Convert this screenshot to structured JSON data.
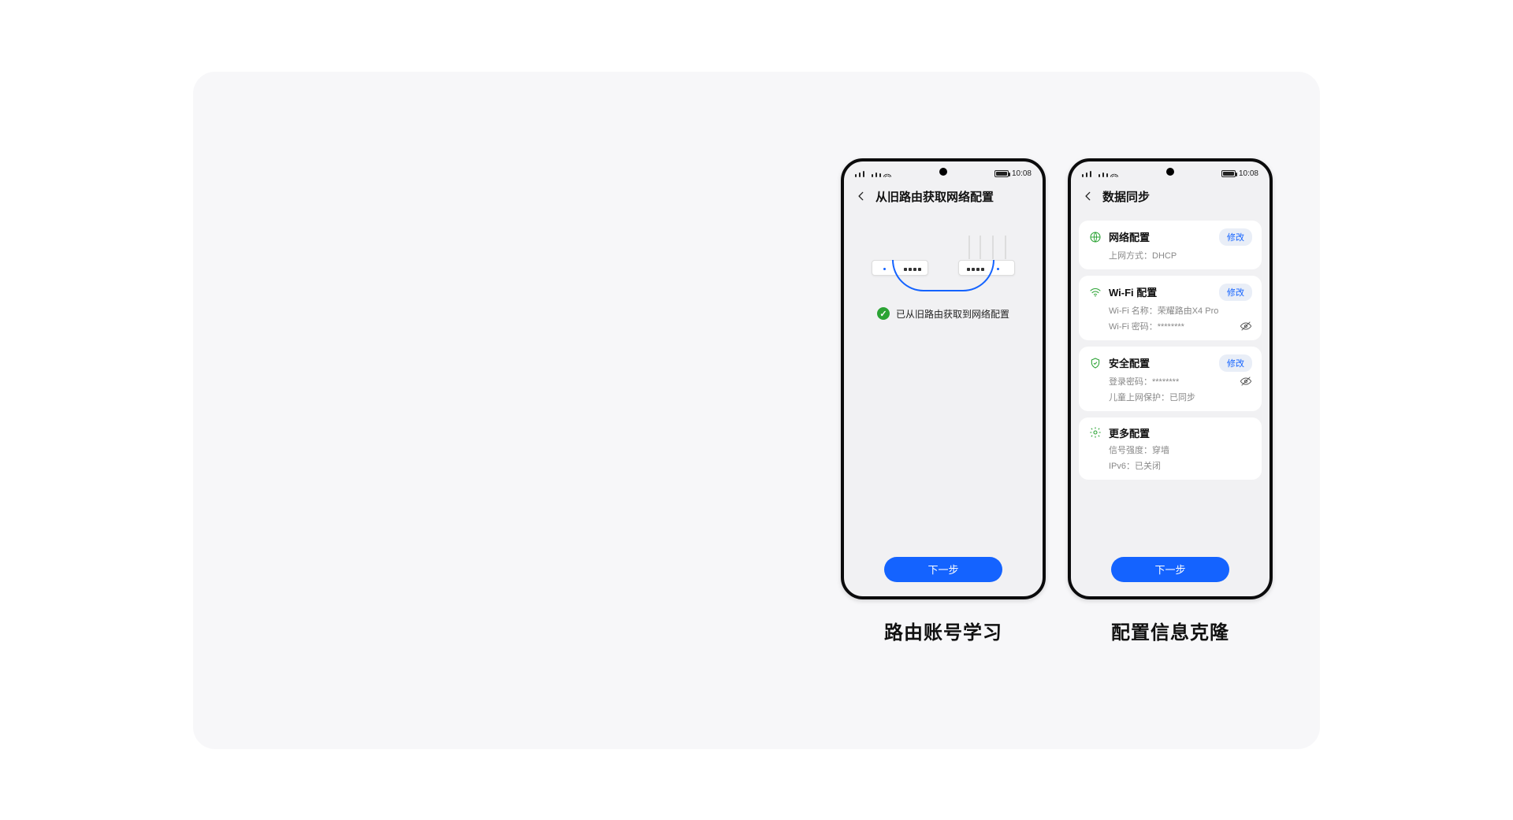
{
  "statusbar": {
    "time": "10:08"
  },
  "phone1": {
    "title": "从旧路由获取网络配置",
    "success": "已从旧路由获取到网络配置",
    "next": "下一步",
    "caption": "路由账号学习"
  },
  "phone2": {
    "title": "数据同步",
    "next": "下一步",
    "caption": "配置信息克隆",
    "edit_label": "修改",
    "sections": {
      "network": {
        "title": "网络配置",
        "mode_key": "上网方式：",
        "mode_val": "DHCP"
      },
      "wifi": {
        "title": "Wi-Fi 配置",
        "name_key": "Wi-Fi 名称：",
        "name_val": "荣耀路由X4 Pro",
        "pwd_key": "Wi-Fi 密码：",
        "pwd_val": "********"
      },
      "security": {
        "title": "安全配置",
        "pwd_key": "登录密码：",
        "pwd_val": "********",
        "child_key": "儿童上网保护：",
        "child_val": "已同步"
      },
      "more": {
        "title": "更多配置",
        "signal_key": "信号强度：",
        "signal_val": "穿墙",
        "ipv6_key": "IPv6：",
        "ipv6_val": "已关闭"
      }
    }
  }
}
